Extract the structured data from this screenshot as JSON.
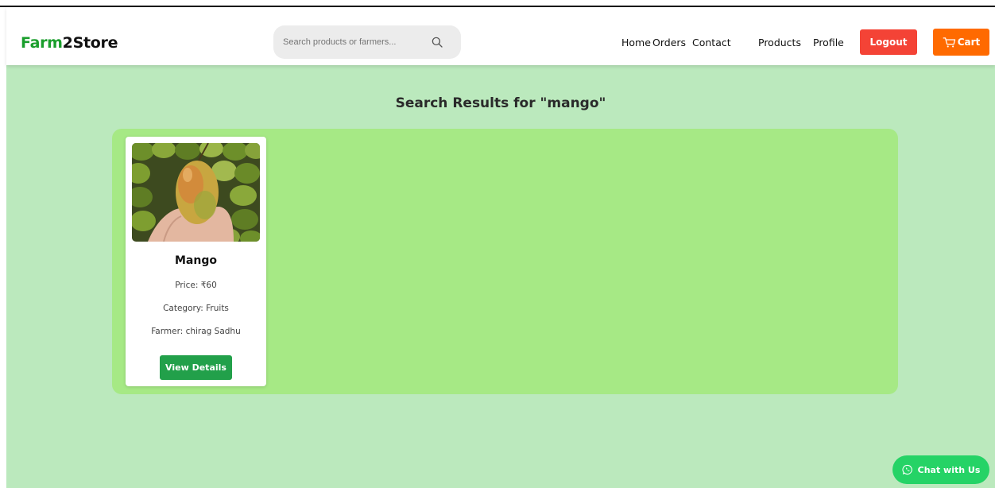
{
  "brand": {
    "part1": "Farm",
    "part2": "2Store",
    "color_part1": "#1a9e2c",
    "color_part2": "#111111"
  },
  "search": {
    "placeholder": "Search products or farmers...",
    "value": "",
    "icon": "search-icon"
  },
  "nav": {
    "home": "Home",
    "orders": "Orders",
    "contact": "Contact",
    "products": "Products",
    "profile": "Profile"
  },
  "buttons": {
    "logout": "Logout",
    "cart": "Cart",
    "cart_icon": "cart-icon",
    "logout_color": "#f44336",
    "cart_color": "#ff6a00"
  },
  "results": {
    "heading": "Search Results for \"mango\"",
    "background": "#a6e985",
    "items": [
      {
        "name": "Mango",
        "price": "Price: ₹60",
        "category": "Category: Fruits",
        "farmer": "Farmer: chirag Sadhu",
        "button": "View Details",
        "image_alt": "mango-photo"
      }
    ]
  },
  "chat": {
    "label": "Chat with Us",
    "icon": "whatsapp-icon",
    "color": "#25d366"
  },
  "colors": {
    "page_bg": "#bbe9bd",
    "accent_green": "#22a04a"
  }
}
